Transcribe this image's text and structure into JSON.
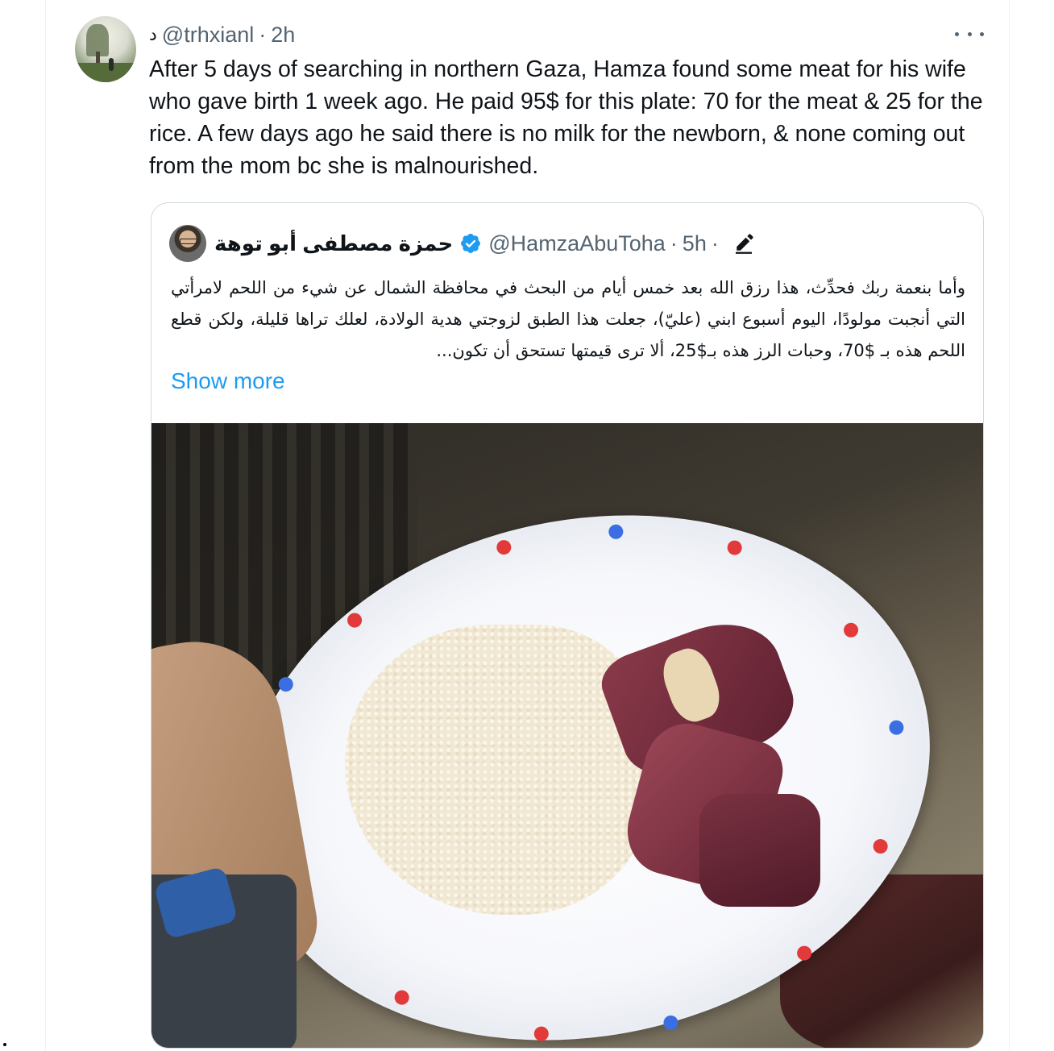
{
  "tweet": {
    "handle_glyph": "د",
    "handle": "@trhxianl",
    "separator": "·",
    "time": "2h",
    "more_icon": "more-horizontal-icon",
    "text": "After 5 days of searching in northern Gaza, Hamza found some meat for his wife who gave birth 1 week ago. He paid 95$ for this plate: 70 for the meat & 25 for the rice. A few days ago he said there is no milk for the newborn, & none coming out from the mom bc she is malnourished."
  },
  "quote": {
    "name": "حمزة مصطفى أبو توهة",
    "verified_icon": "verified-badge-icon",
    "handle": "@HamzaAbuToha",
    "separator": "·",
    "time": "5h",
    "time_suffix": "·",
    "edit_icon": "edited-pencil-icon",
    "text": "وأما بنعمة ربك فحدِّث، هذا رزق الله بعد خمس أيام من البحث في محافظة الشمال عن شيء من اللحم لامرأتي التي أنجبت مولودًا، اليوم أسبوع ابني (عليّ)، جعلت هذا الطبق لزوجتي هدية الولادة، لعلك تراها قليلة، ولكن قطع اللحم هذه بـ $70، وحبات الرز هذه بـ$25، ألا ترى قيمتها تستحق أن تكون...",
    "show_more": "Show more"
  },
  "colors": {
    "link": "#1d9bf0",
    "verified": "#1d9bf0",
    "secondary_text": "#536471",
    "border": "#cfd9de"
  }
}
